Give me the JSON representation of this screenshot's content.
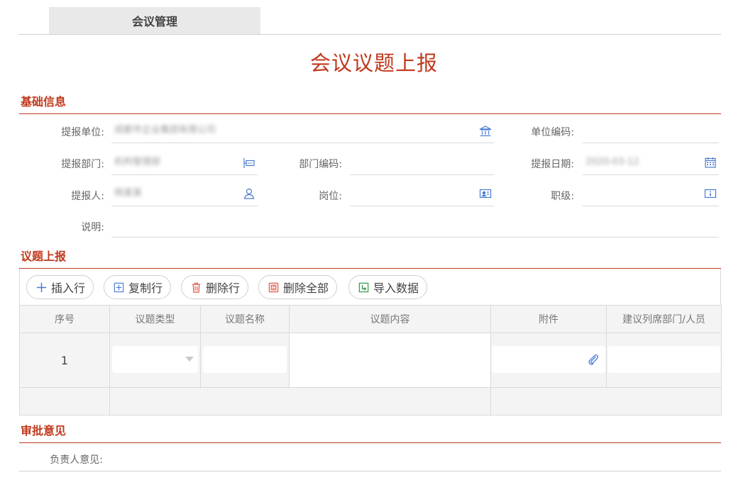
{
  "tab": {
    "label": "会议管理"
  },
  "page": {
    "title": "会议议题上报"
  },
  "sections": {
    "basic": "基础信息",
    "topics": "议题上报",
    "approval": "审批意见"
  },
  "form": {
    "unit": {
      "label": "提报单位:",
      "value": "成都市企业集团有限公司"
    },
    "unit_code": {
      "label": "单位编码:",
      "value": ""
    },
    "dept": {
      "label": "提报部门:",
      "value": "机构管理部"
    },
    "dept_code": {
      "label": "部门编码:",
      "value": ""
    },
    "date": {
      "label": "提报日期:",
      "value": "2020-03-12"
    },
    "person": {
      "label": "提报人:",
      "value": "杨某某"
    },
    "post": {
      "label": "岗位:",
      "value": ""
    },
    "rank": {
      "label": "职级:",
      "value": ""
    },
    "note": {
      "label": "说明:",
      "value": ""
    },
    "leader_opinion": {
      "label": "负责人意见:",
      "value": ""
    }
  },
  "toolbar": {
    "insert": "插入行",
    "copy": "复制行",
    "delete": "删除行",
    "delete_all": "删除全部",
    "import": "导入数据"
  },
  "grid": {
    "columns": [
      "序号",
      "议题类型",
      "议题名称",
      "议题内容",
      "附件",
      "建议列席部门/人员"
    ],
    "rows": [
      {
        "index": "1",
        "type": "",
        "name": "",
        "content": "",
        "attachment": "",
        "attendees": ""
      }
    ]
  },
  "colors": {
    "accent": "#c0391d",
    "icon": "#4a7bd0"
  }
}
